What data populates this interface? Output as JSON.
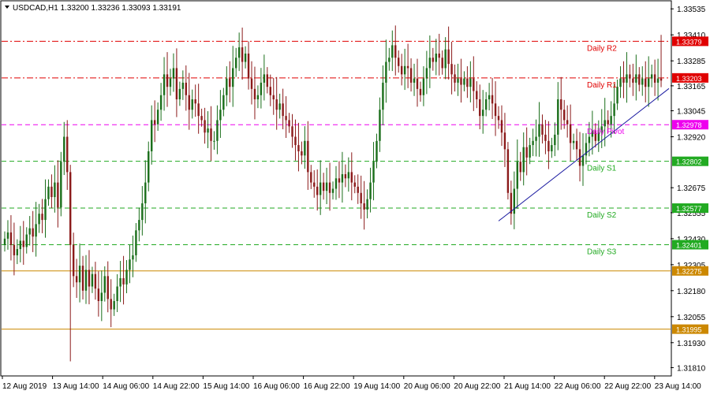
{
  "chart_data": {
    "type": "candlestick",
    "title": "USDCAD,H1  1.33200 1.33236 1.33093 1.33191",
    "y_axis": {
      "ylim": [
        1.3177,
        1.3357
      ],
      "tick_labels": [
        "1.33535",
        "1.33410",
        "1.33285",
        "1.33165",
        "1.33045",
        "1.32920",
        "1.32675",
        "1.32555",
        "1.32430",
        "1.32305",
        "1.32180",
        "1.32055",
        "1.31930",
        "1.31810"
      ],
      "position": "right"
    },
    "x_axis": {
      "tick_labels": [
        "12 Aug 2019",
        "13 Aug 14:00",
        "14 Aug 06:00",
        "14 Aug 22:00",
        "15 Aug 14:00",
        "16 Aug 06:00",
        "16 Aug 22:00",
        "19 Aug 14:00",
        "20 Aug 06:00",
        "20 Aug 22:00",
        "21 Aug 14:00",
        "22 Aug 06:00",
        "22 Aug 22:00",
        "23 Aug 14:00"
      ]
    },
    "grid": false,
    "horizontal_levels": [
      {
        "value": 1.33379,
        "label": "1.33379",
        "annotation": "Daily R2",
        "color": "#e00000",
        "style": "dashdot"
      },
      {
        "value": 1.33203,
        "label": "1.33203",
        "annotation": "Daily R1",
        "color": "#e00000",
        "style": "dashdot"
      },
      {
        "value": 1.32978,
        "label": "1.32978",
        "annotation": "Daily Pivot",
        "color": "#ee00ee",
        "style": "dashed"
      },
      {
        "value": 1.32802,
        "label": "1.32802",
        "annotation": "Daily S1",
        "color": "#22aa22",
        "style": "dashed"
      },
      {
        "value": 1.32577,
        "label": "1.32577",
        "annotation": "Daily S2",
        "color": "#22aa22",
        "style": "dashed"
      },
      {
        "value": 1.32401,
        "label": "1.32401",
        "annotation": "Daily S3",
        "color": "#22aa22",
        "style": "dashed"
      },
      {
        "value": 1.32275,
        "label": "1.32275",
        "annotation": "",
        "color": "#cc8800",
        "style": "solid"
      },
      {
        "value": 1.31995,
        "label": "1.31995",
        "annotation": "",
        "color": "#cc8800",
        "style": "solid"
      }
    ],
    "trendline": {
      "points": [
        [
          1.32515
        ],
        [
          1.33152
        ]
      ],
      "color": "#1a1aa0"
    },
    "candles_up_color": "#1a6e1a",
    "candles_down_color": "#8b1a1a",
    "series_close": [
      1.3243,
      1.3246,
      1.324,
      1.3235,
      1.3238,
      1.3242,
      1.3239,
      1.3245,
      1.3248,
      1.3244,
      1.325,
      1.3255,
      1.3252,
      1.3262,
      1.3268,
      1.3263,
      1.327,
      1.3258,
      1.328,
      1.3292,
      1.3275,
      1.324,
      1.3225,
      1.3222,
      1.323,
      1.3218,
      1.3228,
      1.322,
      1.3226,
      1.3219,
      1.3213,
      1.3217,
      1.3225,
      1.3214,
      1.3209,
      1.3213,
      1.322,
      1.3224,
      1.3221,
      1.3228,
      1.3233,
      1.3235,
      1.3247,
      1.3252,
      1.326,
      1.327,
      1.3285,
      1.33,
      1.3298,
      1.3305,
      1.3312,
      1.3322,
      1.3316,
      1.332,
      1.3325,
      1.331,
      1.3315,
      1.3318,
      1.3312,
      1.3305,
      1.331,
      1.3308,
      1.3302,
      1.33,
      1.3294,
      1.3296,
      1.329,
      1.329,
      1.33,
      1.3305,
      1.3312,
      1.332,
      1.3316,
      1.3325,
      1.333,
      1.3335,
      1.3328,
      1.3332,
      1.332,
      1.3315,
      1.331,
      1.3312,
      1.3318,
      1.3322,
      1.3316,
      1.3312,
      1.331,
      1.3305,
      1.3308,
      1.3302,
      1.33,
      1.3297,
      1.3292,
      1.3288,
      1.3285,
      1.3283,
      1.329,
      1.3275,
      1.327,
      1.3268,
      1.3264,
      1.327,
      1.3266,
      1.327,
      1.3265,
      1.3267,
      1.3272,
      1.327,
      1.3274,
      1.3272,
      1.3275,
      1.327,
      1.3268,
      1.3265,
      1.326,
      1.3257,
      1.3262,
      1.327,
      1.328,
      1.329,
      1.3305,
      1.3318,
      1.3328,
      1.333,
      1.3336,
      1.333,
      1.3326,
      1.3322,
      1.3326,
      1.3325,
      1.3318,
      1.332,
      1.3315,
      1.3312,
      1.332,
      1.3325,
      1.333,
      1.3328,
      1.3332,
      1.333,
      1.3325,
      1.3334,
      1.3327,
      1.3322,
      1.3318,
      1.332,
      1.3317,
      1.332,
      1.3316,
      1.332,
      1.3314,
      1.331,
      1.3302,
      1.3305,
      1.331,
      1.3312,
      1.3308,
      1.3302,
      1.33,
      1.3294,
      1.3286,
      1.3265,
      1.3255,
      1.3267,
      1.328,
      1.3275,
      1.3287,
      1.3282,
      1.3288,
      1.329,
      1.3292,
      1.3298,
      1.3293,
      1.329,
      1.3285,
      1.3288,
      1.3293,
      1.331,
      1.3305,
      1.33,
      1.3298,
      1.3289,
      1.329,
      1.3286,
      1.3278,
      1.3283,
      1.3289,
      1.3292,
      1.3295,
      1.329,
      1.3294,
      1.3297,
      1.33,
      1.3298,
      1.3302,
      1.3308,
      1.3316,
      1.332,
      1.3318,
      1.3322,
      1.332,
      1.3318,
      1.3322,
      1.3317,
      1.332,
      1.3316,
      1.332,
      1.3322,
      1.3318,
      1.332,
      1.3319
    ]
  }
}
